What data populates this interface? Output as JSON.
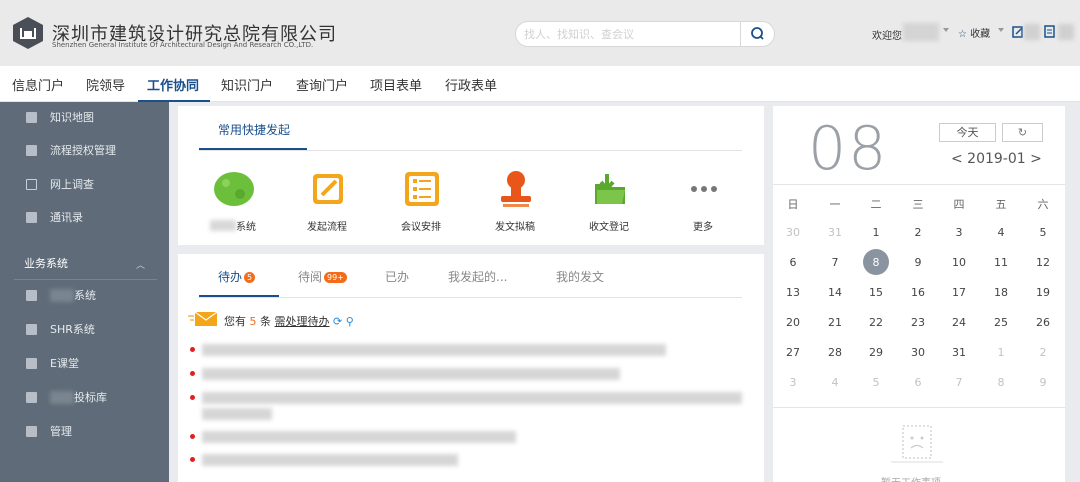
{
  "header": {
    "brand_cn": "深圳市建筑设计研究总院有限公司",
    "brand_en": "Shenzhen General Institute Of Architectural Design And Research CO.,LTD.",
    "search_placeholder": "找人、找知识、查会议",
    "welcome": "欢迎您",
    "favorites": "收藏"
  },
  "nav": {
    "items": [
      "信息门户",
      "院领导",
      "工作协同",
      "知识门户",
      "查询门户",
      "项目表单",
      "行政表单"
    ],
    "active_index": 2
  },
  "sidebar": {
    "items": [
      {
        "label": "知识地图",
        "icon": "doc-icon"
      },
      {
        "label": "流程授权管理",
        "icon": "doc-icon"
      },
      {
        "label": "网上调查",
        "icon": "checkbox-icon"
      },
      {
        "label": "通讯录",
        "icon": "doc-icon"
      }
    ],
    "group": {
      "label": "业务系统",
      "expanded": true
    },
    "group_items": [
      {
        "label": "系统"
      },
      {
        "label": "SHR系统"
      },
      {
        "label": "E课堂"
      },
      {
        "label": "投标库"
      },
      {
        "label": "管理"
      }
    ]
  },
  "shortcuts": {
    "tab": "常用快捷发起",
    "items": [
      {
        "label": "系统",
        "icon": "green-blob-icon"
      },
      {
        "label": "发起流程",
        "icon": "edit-icon"
      },
      {
        "label": "会议安排",
        "icon": "list-icon"
      },
      {
        "label": "发文拟稿",
        "icon": "stamp-icon"
      },
      {
        "label": "收文登记",
        "icon": "folder-icon"
      },
      {
        "label": "更多",
        "icon": "more-icon"
      }
    ]
  },
  "todo": {
    "tabs": [
      {
        "label": "待办",
        "badge": "5"
      },
      {
        "label": "待阅",
        "badge": "99+"
      },
      {
        "label": "已办",
        "badge": ""
      },
      {
        "label": "我发起的...",
        "badge": ""
      },
      {
        "label": "我的发文",
        "badge": ""
      }
    ],
    "notice_prefix": "您有",
    "notice_count": "5",
    "notice_unit": "条",
    "notice_link": "需处理待办"
  },
  "calendar": {
    "day": "08",
    "today_label": "今天",
    "month_label": "< 2019-01 >",
    "weekdays": [
      "日",
      "一",
      "二",
      "三",
      "四",
      "五",
      "六"
    ],
    "weeks": [
      [
        "30",
        "31",
        "1",
        "2",
        "3",
        "4",
        "5"
      ],
      [
        "6",
        "7",
        "8",
        "9",
        "10",
        "11",
        "12"
      ],
      [
        "13",
        "14",
        "15",
        "16",
        "17",
        "18",
        "19"
      ],
      [
        "20",
        "21",
        "22",
        "23",
        "24",
        "25",
        "26"
      ],
      [
        "27",
        "28",
        "29",
        "30",
        "31",
        "1",
        "2"
      ],
      [
        "3",
        "4",
        "5",
        "6",
        "7",
        "8",
        "9"
      ]
    ],
    "selected": "8",
    "empty_text": "暂无工作事项"
  },
  "colors": {
    "accent": "#1a4f8c",
    "badge": "#f36c1a",
    "sidebar": "#5f6b78"
  }
}
